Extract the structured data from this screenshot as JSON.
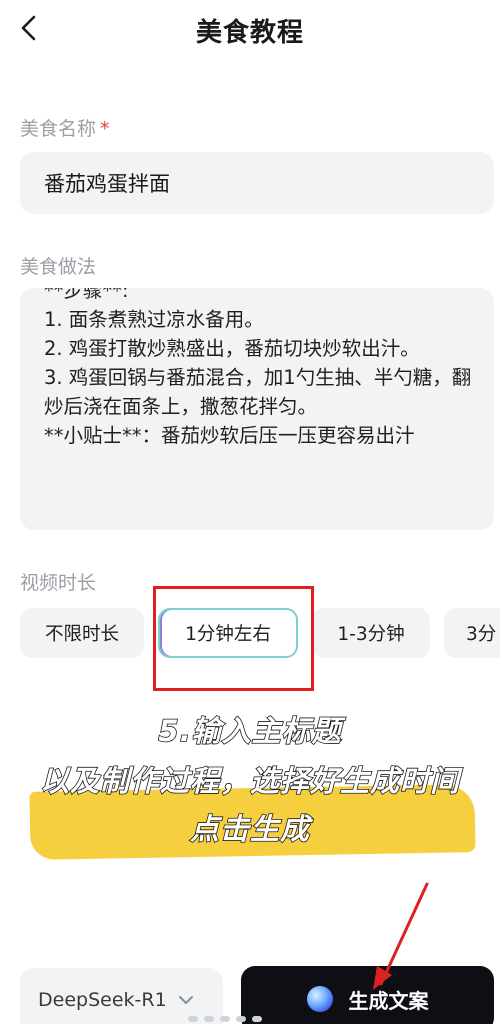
{
  "header": {
    "title": "美食教程",
    "back_icon": "chevron-left-icon"
  },
  "food_name": {
    "label": "美食名称",
    "required_mark": "*",
    "value": "番茄鸡蛋拌面"
  },
  "method": {
    "label": "美食做法",
    "value": "**步骤**:\n1. 面条煮熟过凉水备用。\n2. 鸡蛋打散炒熟盛出，番茄切块炒软出汁。\n3. 鸡蛋回锅与番茄混合，加1勺生抽、半勺糖，翻炒后浇在面条上，撒葱花拌匀。\n**小贴士**：番茄炒软后压一压更容易出汁"
  },
  "duration": {
    "label": "视频时长",
    "options": [
      "不限时长",
      "1分钟左右",
      "1-3分钟",
      "3分"
    ],
    "selected": "1分钟左右"
  },
  "overlay": {
    "line1": "5.输入主标题",
    "line2": "以及制作过程，选择好生成时间",
    "line3": "点击生成",
    "marker_color": "#f6cf3f",
    "box_color": "#e02020"
  },
  "bottom": {
    "model": "DeepSeek-R1",
    "model_icon": "chevron-down-icon",
    "generate_label": "生成文案",
    "generate_icon": "orb-icon"
  }
}
